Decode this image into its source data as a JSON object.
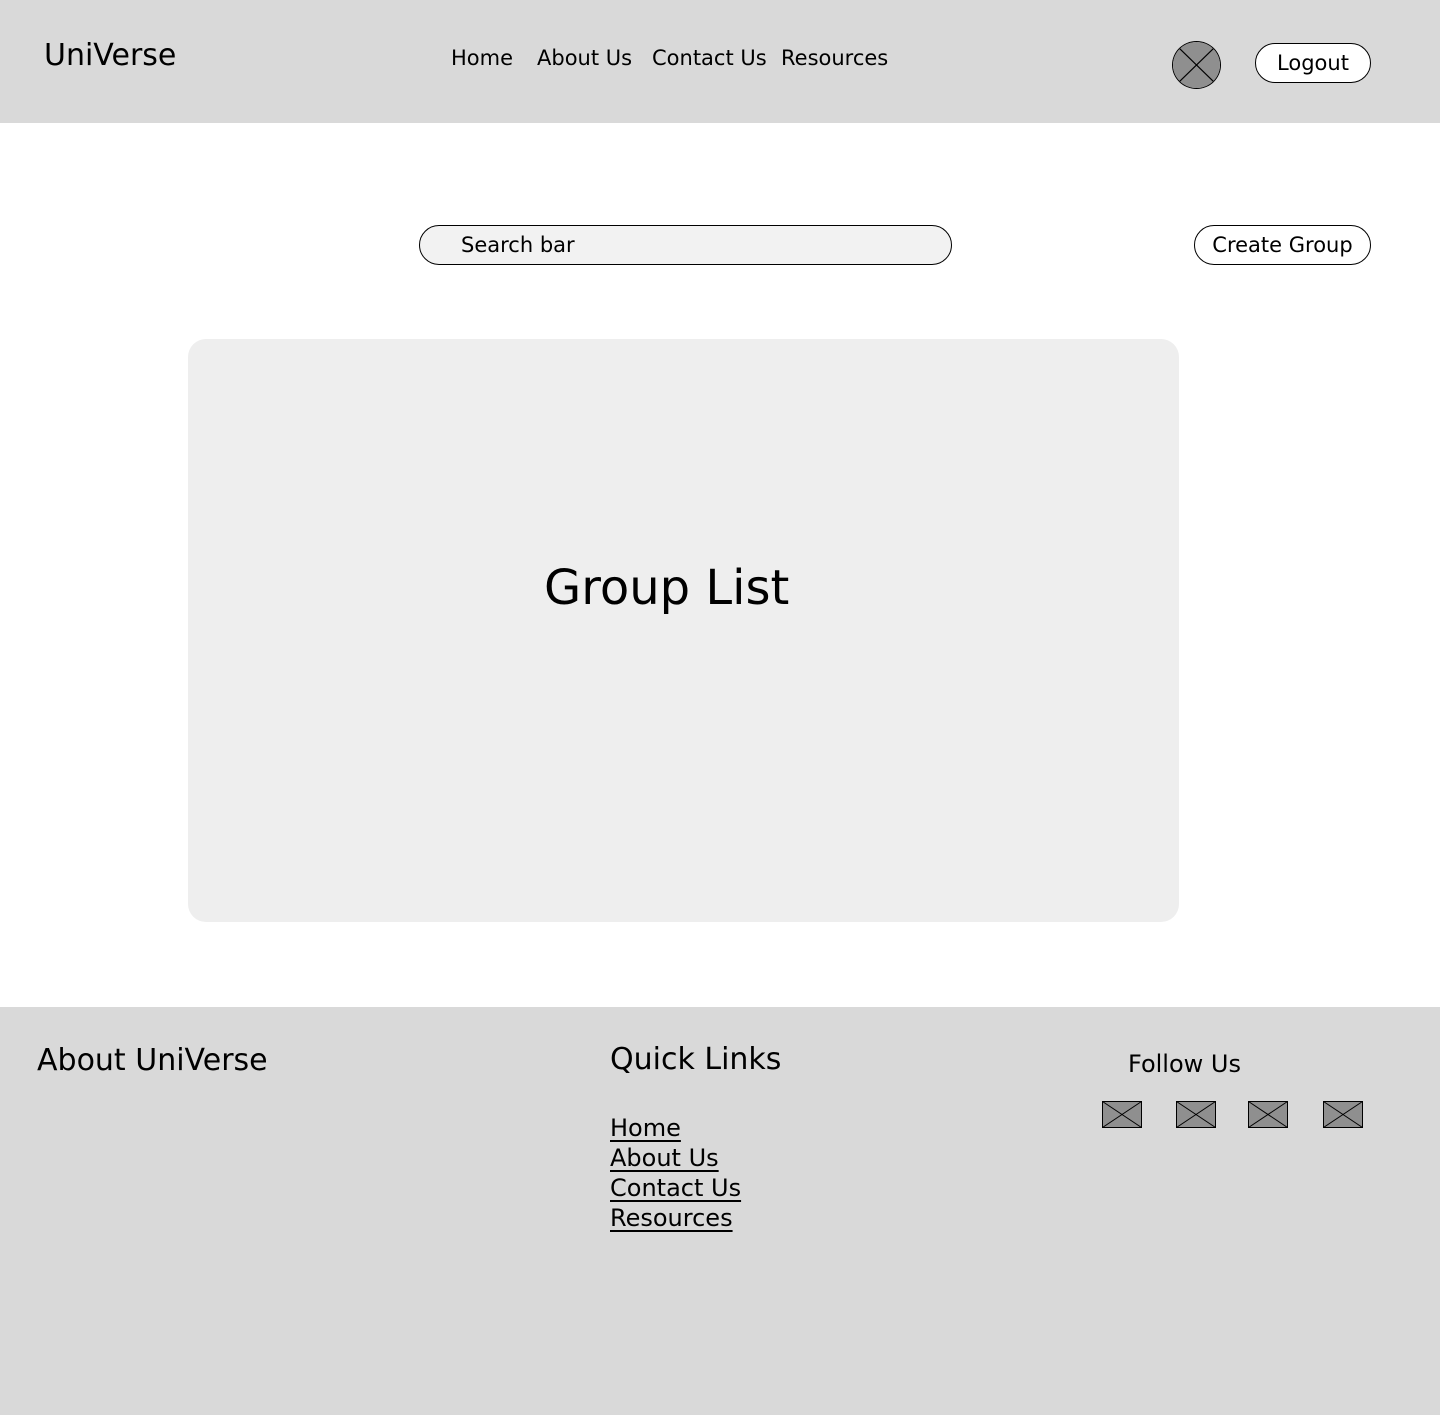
{
  "header": {
    "brand": "UniVerse",
    "nav": [
      "Home",
      "About Us",
      "Contact Us",
      "Resources"
    ],
    "avatar_icon": "image-placeholder-icon",
    "logout_label": "Logout"
  },
  "toolbar": {
    "search_placeholder": "Search bar",
    "create_label": "Create Group"
  },
  "main": {
    "group_list_title": "Group List"
  },
  "footer": {
    "about_title": "About UniVerse",
    "quick_links_title": "Quick Links",
    "quick_links": [
      "Home",
      "About Us",
      "Contact Us",
      "Resources"
    ],
    "follow_title": "Follow Us",
    "social_icons": [
      "image-placeholder-icon",
      "image-placeholder-icon",
      "image-placeholder-icon",
      "image-placeholder-icon"
    ]
  },
  "colors": {
    "header_footer_bg": "#d9d9d9",
    "panel_bg": "#eeeeee",
    "search_bg": "#f2f2f2",
    "placeholder_fill": "#8f8f8f"
  }
}
